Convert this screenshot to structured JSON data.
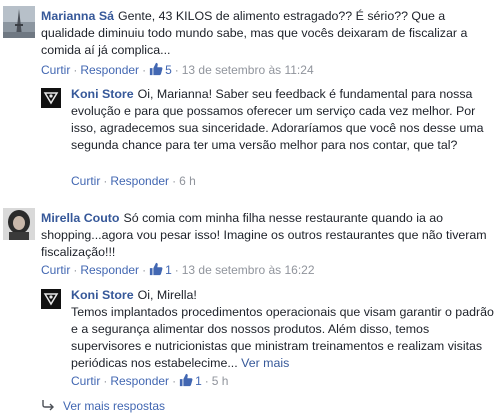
{
  "comments": [
    {
      "author": "Marianna Sá",
      "text": "Gente, 43 KILOS de alimento estragado?? É sério?? Que a qualidade diminuiu todo mundo sabe, mas que vocês deixaram de fiscalizar a comida aí já complica...",
      "actions": {
        "like": "Curtir",
        "reply": "Responder"
      },
      "likes": "5",
      "time": "13 de setembro às 11:24",
      "reply": {
        "author": "Koni Store",
        "text": "Oi, Marianna! Saber seu feedback é fundamental para nossa evolução e para que possamos oferecer um serviço cada vez melhor. Por isso, agradecemos sua sinceridade. Adoraríamos que você nos desse uma segunda chance para ter uma versão melhor para nos contar, que tal?",
        "actions": {
          "like": "Curtir",
          "reply": "Responder"
        },
        "time": "6 h"
      }
    },
    {
      "author": "Mirella Couto",
      "text": "Só comia com minha filha nesse restaurante quando ia ao shopping...agora vou pesar isso! Imagine os outros restaurantes que não tiveram fiscalização!!!",
      "actions": {
        "like": "Curtir",
        "reply": "Responder"
      },
      "likes": "1",
      "time": "13 de setembro às 16:22",
      "reply": {
        "author": "Koni Store",
        "text_line1": "Oi, Mirella!",
        "text": "Temos implantados procedimentos operacionais que visam garantir o padrão e a segurança alimentar dos nossos produtos. Além disso, temos supervisores e nutricionistas que ministram treinamentos e realizam visitas periódicas nos estabelecime...",
        "more": "Ver mais",
        "actions": {
          "like": "Curtir",
          "reply": "Responder"
        },
        "likes": "1",
        "time": "5 h"
      }
    }
  ],
  "view_more_replies": "Ver mais respostas",
  "icons": {
    "like": "thumbs-up-icon",
    "reply_arrow": "reply-arrow-icon"
  },
  "colors": {
    "link": "#365899",
    "action": "#4267b2",
    "meta": "#90949c"
  }
}
